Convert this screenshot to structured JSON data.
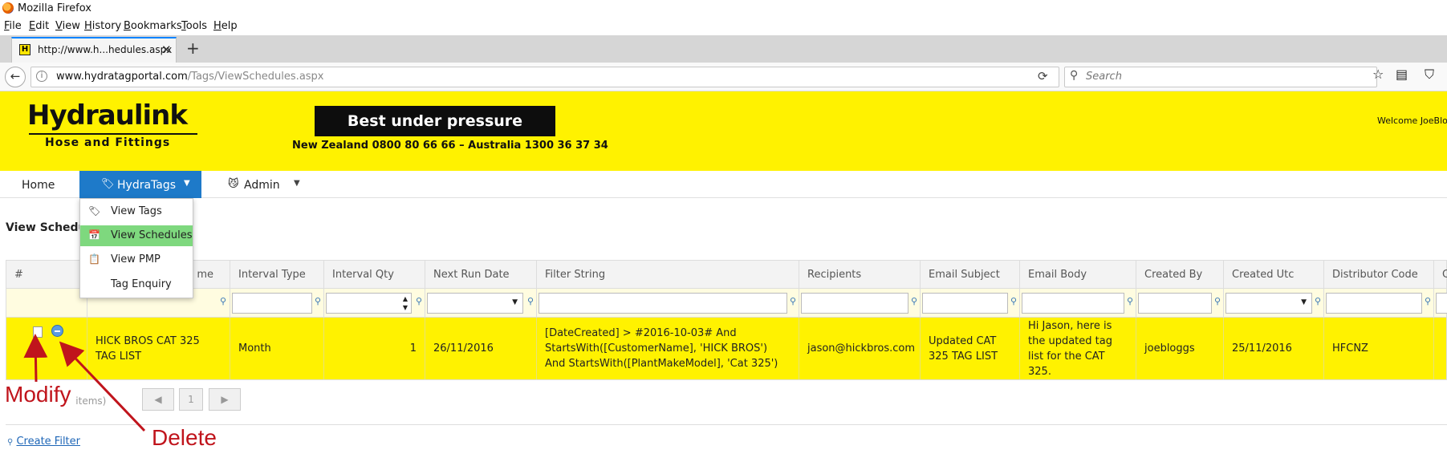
{
  "window": {
    "title": "Mozilla Firefox"
  },
  "menubar": [
    "File",
    "Edit",
    "View",
    "History",
    "Bookmarks",
    "Tools",
    "Help"
  ],
  "tab": {
    "title": "http://www.h...hedules.aspx",
    "favicon_letter": "H"
  },
  "address": {
    "domain": "www.hydratagportal.com",
    "path": "/Tags/ViewSchedules.aspx"
  },
  "search": {
    "placeholder": "Search"
  },
  "header": {
    "logo_main": "Hydraulink",
    "logo_sub": "Hose and Fittings",
    "slogan": "Best under pressure",
    "phones": "New Zealand 0800 80 66 66 – Australia 1300 36 37 34",
    "welcome": "Welcome JoeBlo"
  },
  "nav": {
    "home": "Home",
    "hydratags": "HydraTags",
    "admin": "Admin"
  },
  "dropdown": [
    {
      "label": "View Tags",
      "icon": "tag-icon",
      "active": false
    },
    {
      "label": "View Schedules",
      "icon": "schedule-icon",
      "active": true
    },
    {
      "label": "View PMP",
      "icon": "checklist-icon",
      "active": false
    },
    {
      "label": "Tag Enquiry",
      "icon": "",
      "active": false
    }
  ],
  "page": {
    "title": "View Schedule"
  },
  "grid": {
    "columns": [
      "#",
      "me",
      "Interval Type",
      "Interval Qty",
      "Next Run Date",
      "Filter String",
      "Recipients",
      "Email Subject",
      "Email Body",
      "Created By",
      "Created Utc",
      "Distributor Code",
      "C"
    ],
    "row": {
      "name": "HICK BROS CAT 325 TAG LIST",
      "interval_type": "Month",
      "interval_qty": "1",
      "next_run_date": "26/11/2016",
      "filter_string": "[DateCreated] > #2016-10-03# And StartsWith([CustomerName], 'HICK BROS') And StartsWith([PlantMakeModel], 'Cat 325')",
      "recipients": "jason@hickbros.com",
      "email_subject": "Updated CAT 325 TAG LIST",
      "email_body": "Hi Jason, here is the updated tag list for the CAT 325.",
      "created_by": "joebloggs",
      "created_utc": "25/11/2016",
      "distributor_code": "HFCNZ"
    }
  },
  "pager": {
    "info": "Page 1 of 1 (1 items)",
    "page": "1"
  },
  "links": {
    "create_filter": "Create Filter"
  },
  "annotations": {
    "modify": "Modify",
    "delete": "Delete"
  },
  "colors": {
    "brand_yellow": "#fff200",
    "nav_blue": "#1e7ac9",
    "active_green": "#7ed87e",
    "annotation_red": "#c0141c"
  }
}
